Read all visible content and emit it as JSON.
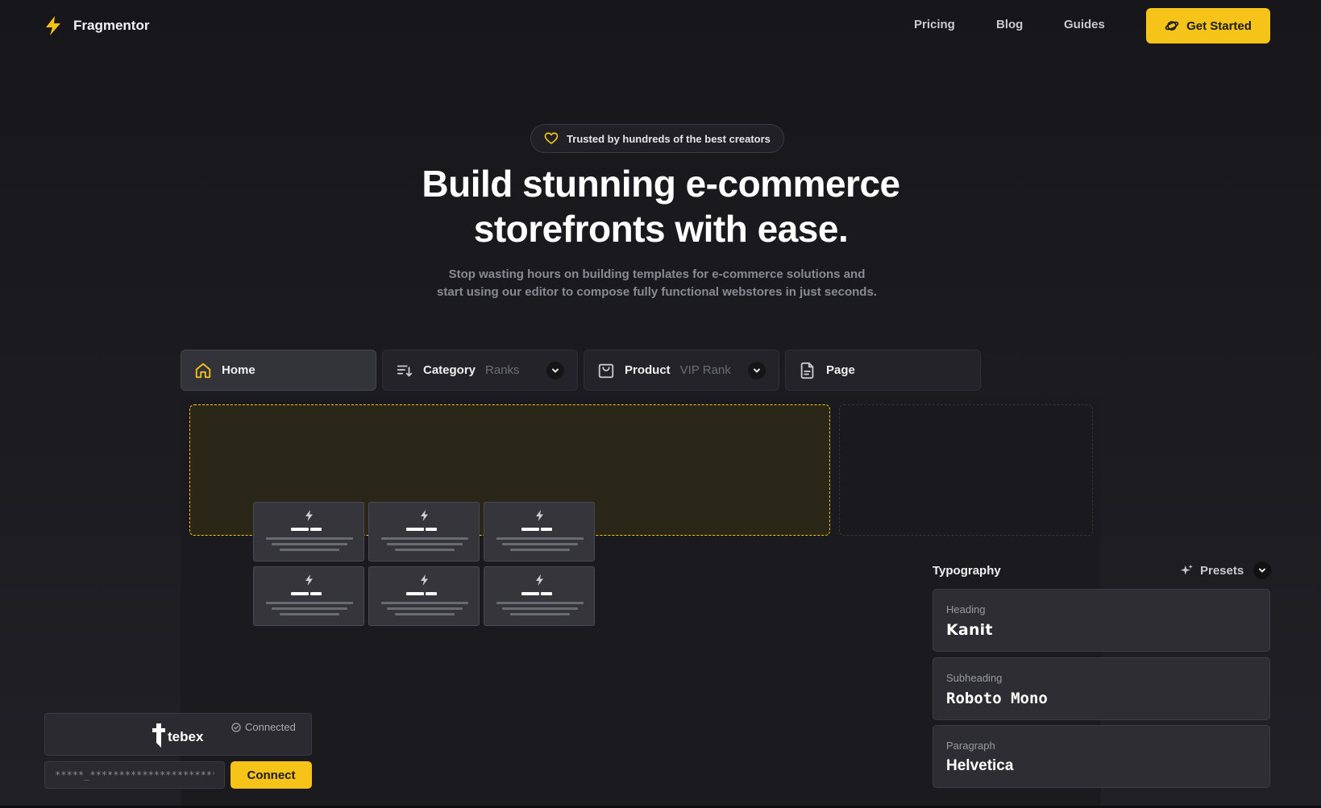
{
  "nav": {
    "brand": "Fragmentor",
    "links": [
      "Pricing",
      "Blog",
      "Guides"
    ],
    "cta_label": "Get Started"
  },
  "hero": {
    "badge": "Trusted by hundreds of the best creators",
    "title_line1": "Build stunning e-commerce",
    "title_line2": "storefronts with ease.",
    "subtitle_line1": "Stop wasting hours on building templates for e-commerce solutions and",
    "subtitle_line2": "start using our editor to compose fully functional webstores in just seconds."
  },
  "tabs": [
    {
      "label": "Home",
      "sub": "",
      "icon": "home-icon",
      "active": true,
      "dropdown": false
    },
    {
      "label": "Category",
      "sub": "Ranks",
      "icon": "sort-list-icon",
      "active": false,
      "dropdown": true
    },
    {
      "label": "Product",
      "sub": "VIP Rank",
      "icon": "bag-icon",
      "active": false,
      "dropdown": true
    },
    {
      "label": "Page",
      "sub": "",
      "icon": "document-icon",
      "active": false,
      "dropdown": false
    }
  ],
  "typography": {
    "title": "Typography",
    "presets_label": "Presets",
    "fonts": [
      {
        "role": "Heading",
        "font": "Kanit"
      },
      {
        "role": "Subheading",
        "font": "Roboto Mono"
      },
      {
        "role": "Paragraph",
        "font": "Helvetica"
      }
    ]
  },
  "tebex": {
    "name": "tebex",
    "status": "Connected",
    "key_value": "*****_**********************",
    "connect_label": "Connect"
  },
  "colors": {
    "accent": "#f6c418",
    "background": "#1c1c21",
    "surface": "#2d2d33"
  }
}
